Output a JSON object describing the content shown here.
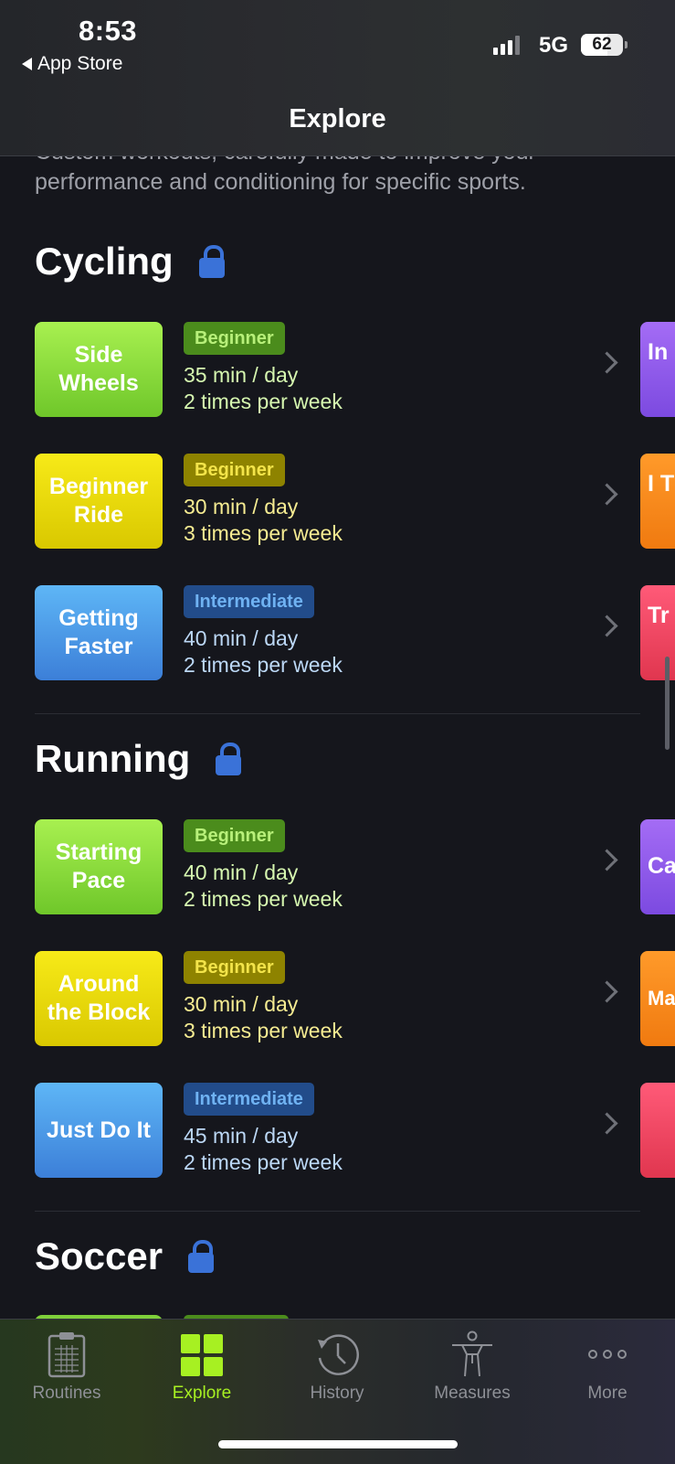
{
  "status_bar": {
    "time": "8:53",
    "back_label": "App Store",
    "network": "5G",
    "battery": "62",
    "battery_level": 0.62
  },
  "nav": {
    "title": "Explore"
  },
  "intro_text": "Custom workouts, carefully made to improve your performance and conditioning for specific sports.",
  "sections": [
    {
      "title": "Cycling",
      "rows": [
        {
          "tile": "Side Wheels",
          "level": "Beginner",
          "duration": "35 min / day",
          "frequency": "2 times per week",
          "peek": "In L"
        },
        {
          "tile": "Beginner Ride",
          "level": "Beginner",
          "duration": "30 min / day",
          "frequency": "3 times per week",
          "peek": "I Th"
        },
        {
          "tile": "Getting Faster",
          "level": "Intermediate",
          "duration": "40 min / day",
          "frequency": "2 times per week",
          "peek": "Tr F"
        }
      ]
    },
    {
      "title": "Running",
      "rows": [
        {
          "tile": "Starting Pace",
          "level": "Beginner",
          "duration": "40 min / day",
          "frequency": "2 times per week",
          "peek": "Ca"
        },
        {
          "tile": "Around the Block",
          "level": "Beginner",
          "duration": "30 min / day",
          "frequency": "3 times per week",
          "peek": "Ma"
        },
        {
          "tile": "Just Do It",
          "level": "Intermediate",
          "duration": "45 min / day",
          "frequency": "2 times per week",
          "peek": ""
        }
      ]
    },
    {
      "title": "Soccer"
    }
  ],
  "tab_bar": {
    "tabs": [
      {
        "label": "Routines",
        "icon": "clipboard-icon"
      },
      {
        "label": "Explore",
        "icon": "grid-icon",
        "active": true
      },
      {
        "label": "History",
        "icon": "history-clock-icon"
      },
      {
        "label": "Measures",
        "icon": "body-figure-icon"
      },
      {
        "label": "More",
        "icon": "more-dots-icon"
      }
    ]
  },
  "colors": {
    "accent": "#a7f022",
    "lock": "#3a72d8",
    "background": "#15161c"
  }
}
